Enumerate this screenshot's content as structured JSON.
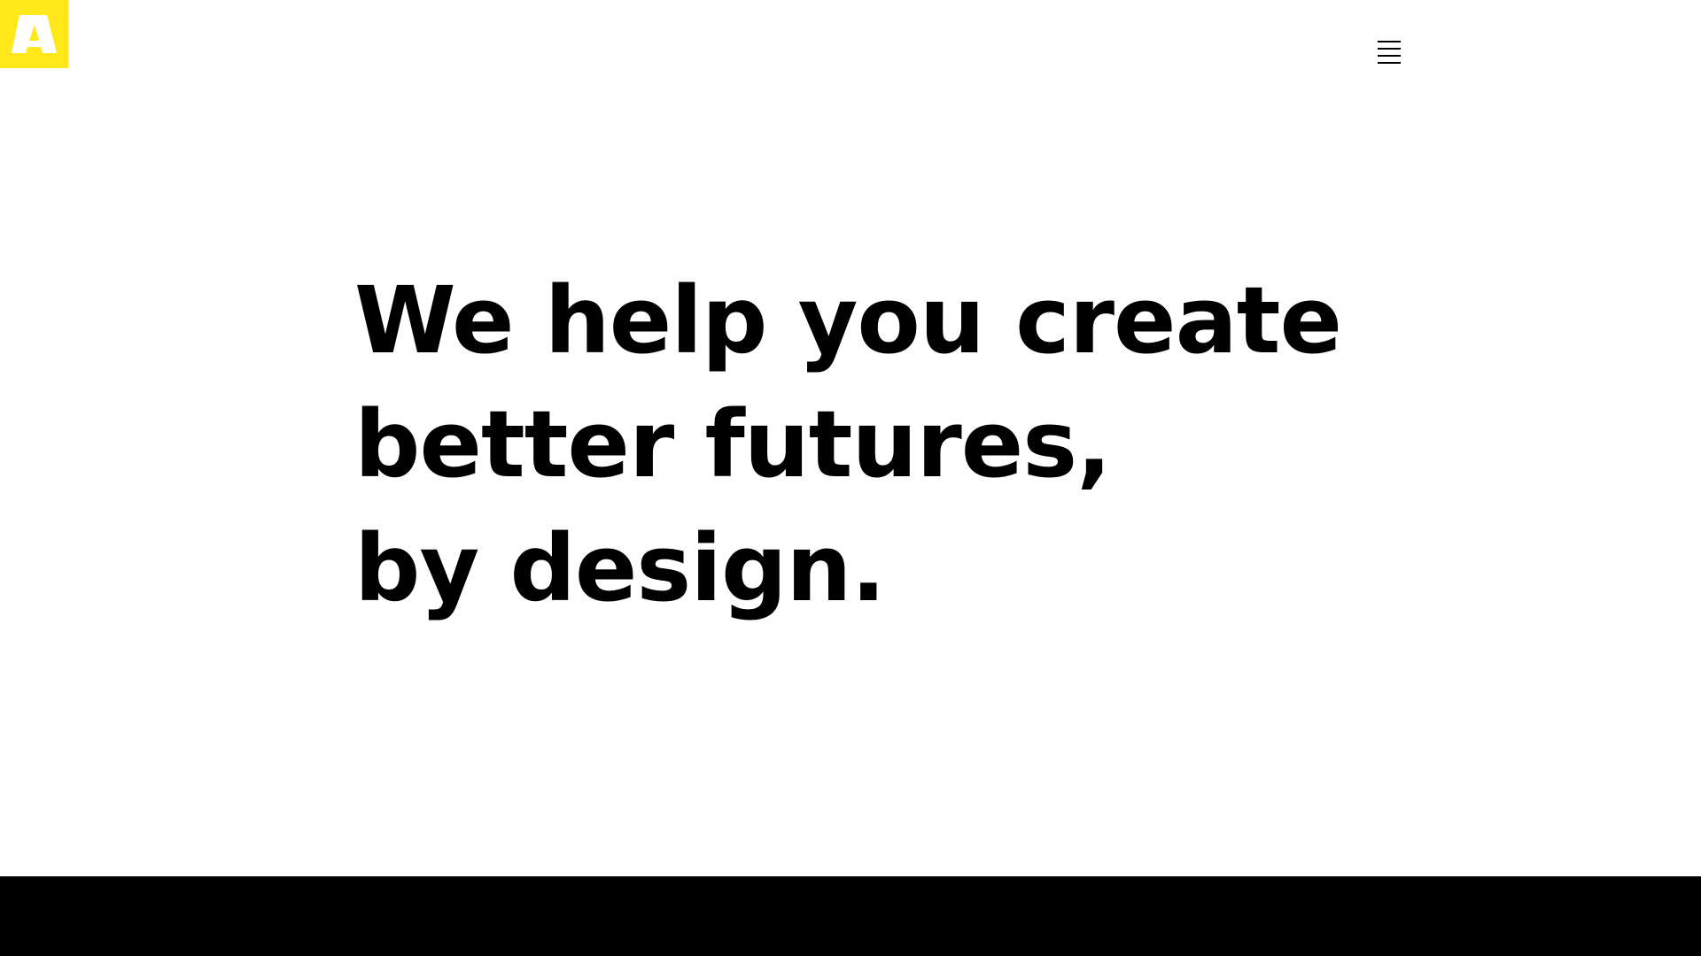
{
  "header": {
    "logo_letter": "A",
    "menu_icon": "hamburger-icon"
  },
  "hero": {
    "lines": [
      "We help you create",
      "better futures,",
      "by design."
    ]
  },
  "colors": {
    "brand_yellow": "#FFE81A",
    "text": "#000000",
    "background": "#FFFFFF",
    "footer": "#000000"
  }
}
